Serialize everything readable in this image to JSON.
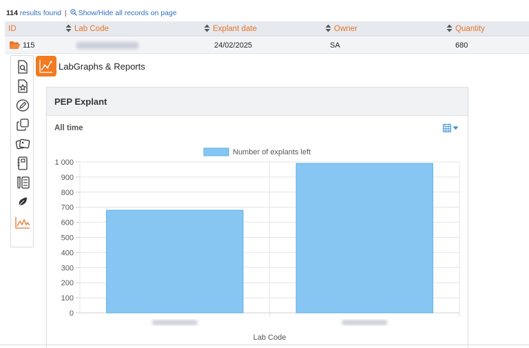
{
  "results": {
    "count": "114",
    "found_text": "results found",
    "separator": "|",
    "toggle_label": "Show/Hide all records on page"
  },
  "table": {
    "columns": [
      "ID",
      "Lab Code",
      "Explant date",
      "Owner",
      "Quantity"
    ],
    "rows": [
      {
        "id": "115",
        "lab_code": "(blurred)",
        "explant_date": "24/02/2025",
        "owner": "SA",
        "quantity": "680"
      }
    ]
  },
  "toolbar": {
    "tools": [
      "magnify-document-icon",
      "star-document-icon",
      "pen-icon",
      "copy-icon",
      "photos-icon",
      "notebook-icon",
      "test-tubes-icon",
      "leaf-icon",
      "line-graph-icon"
    ],
    "active_tool": "line-graph-icon",
    "accent": "#e8742a"
  },
  "app": {
    "title": "LabGraphs & Reports",
    "badge_color": "#f27b21"
  },
  "panel": {
    "title": "PEP Explant",
    "range_label": "All time"
  },
  "chart_data": {
    "type": "bar",
    "categories": [
      "(blurred)",
      "(blurred)"
    ],
    "series": [
      {
        "name": "Number of explants left",
        "values": [
          680,
          990
        ],
        "color": "#87c6f2",
        "border": "#5ab0e8"
      }
    ],
    "xlabel": "Lab Code",
    "ylabel": "",
    "ylim": [
      0,
      1000
    ],
    "yticks": [
      "0",
      "100",
      "200",
      "300",
      "400",
      "500",
      "600",
      "700",
      "800",
      "900",
      "1 000"
    ],
    "grid": true,
    "legend_position": "top"
  }
}
